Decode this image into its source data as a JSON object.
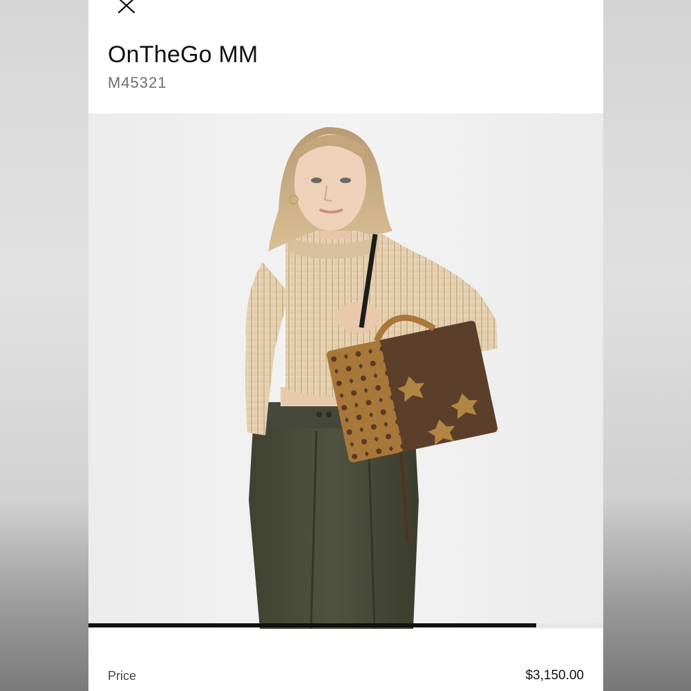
{
  "product": {
    "name": "OnTheGo MM",
    "sku": "M45321"
  },
  "gallery": {
    "image_description_icon": "product-photo",
    "progress": 0.87
  },
  "price": {
    "label": "Price",
    "value": "$3,150.00"
  },
  "icons": {
    "close": "close-icon"
  },
  "colors": {
    "sheet_background": "#ffffff",
    "photo_background": "#efefef",
    "progress_fill": "#111111",
    "title_text": "#111111",
    "secondary_text": "#6f6f6f"
  }
}
